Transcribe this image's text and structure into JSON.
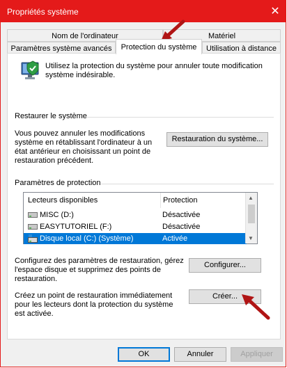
{
  "window": {
    "title": "Propriétés système",
    "close_glyph": "✕"
  },
  "tabs": {
    "row1": [
      {
        "label": "Nom de l'ordinateur"
      },
      {
        "label": "Matériel"
      }
    ],
    "row2": [
      {
        "label": "Paramètres système avancés"
      },
      {
        "label": "Protection du système"
      },
      {
        "label": "Utilisation à distance"
      }
    ]
  },
  "intro": "Utilisez la protection du système pour annuler toute modification système indésirable.",
  "restore": {
    "heading": "Restaurer le système",
    "description": "Vous pouvez annuler les modifications système en rétablissant l'ordinateur à un état antérieur en choisissant un point de restauration précédent.",
    "button": "Restauration du système..."
  },
  "protection": {
    "heading": "Paramètres de protection",
    "columns": {
      "drives": "Lecteurs disponibles",
      "protection": "Protection"
    },
    "drives": [
      {
        "name": "MISC (D:)",
        "status": "Désactivée",
        "icon": "drive-icon",
        "selected": false
      },
      {
        "name": "EASYTUTORIEL (F:)",
        "status": "Désactivée",
        "icon": "drive-icon",
        "selected": false
      },
      {
        "name": "Disque local (C:) (Système)",
        "status": "Activée",
        "icon": "system-drive-icon",
        "selected": true
      }
    ],
    "configure_text": "Configurez des paramètres de restauration, gérez l'espace disque et supprimez des points de restauration.",
    "configure_button": "Configurer...",
    "create_text": "Créez un point de restauration immédiatement pour les lecteurs dont la protection du système est activée.",
    "create_button": "Créer..."
  },
  "footer": {
    "ok": "OK",
    "cancel": "Annuler",
    "apply": "Appliquer"
  },
  "colors": {
    "titlebar": "#e41a1a",
    "selection": "#0078d7",
    "annotation_arrow": "#b01515"
  }
}
